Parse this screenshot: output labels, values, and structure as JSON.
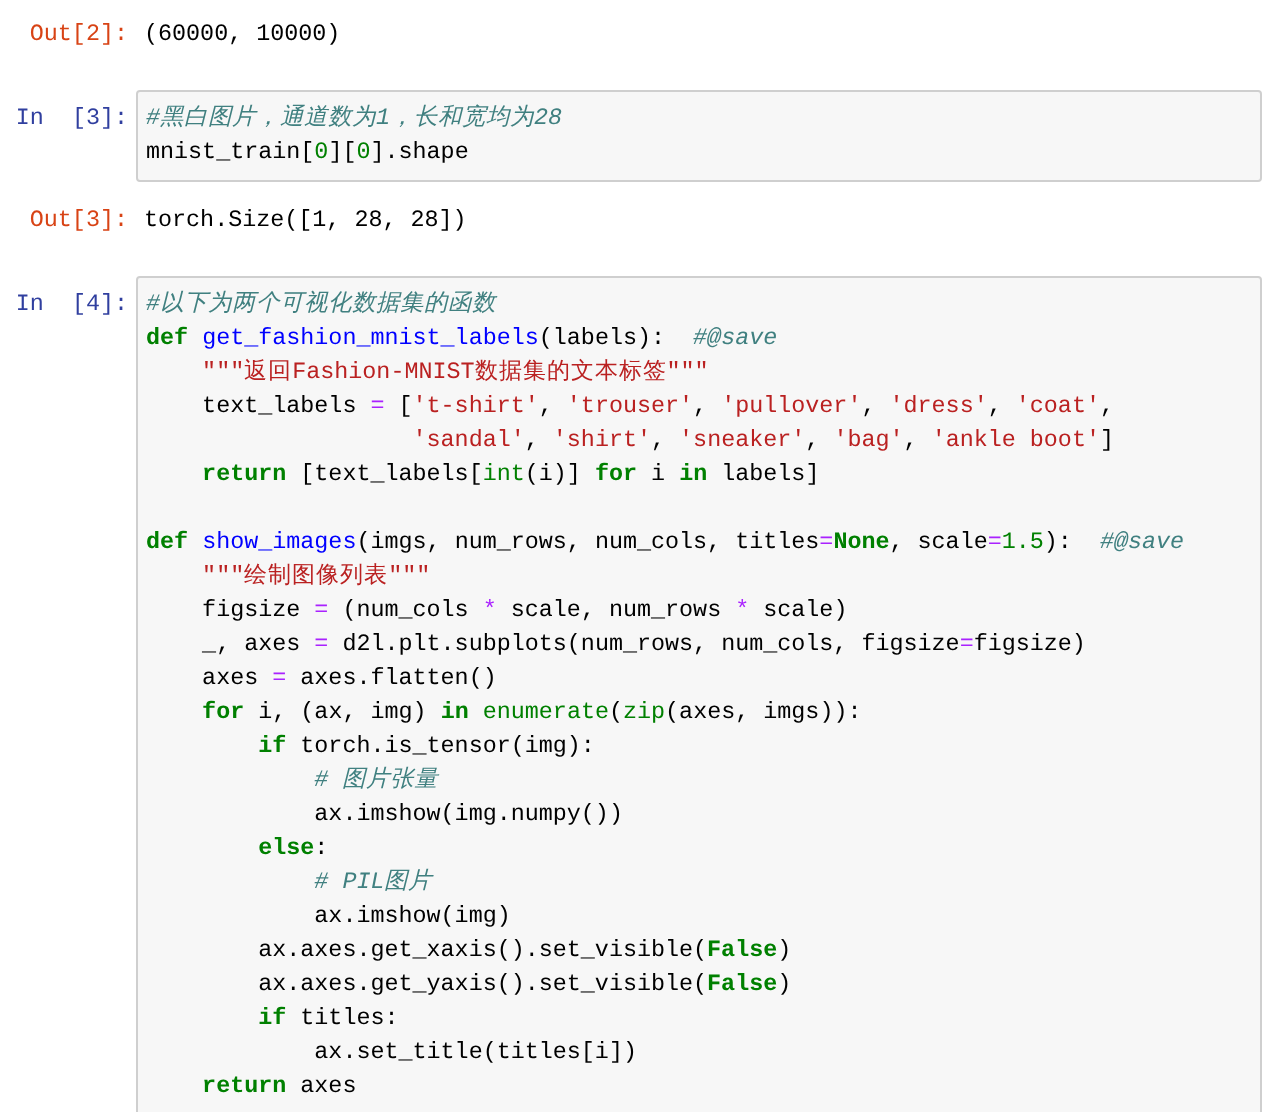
{
  "cells": [
    {
      "kind": "output",
      "prompt": "Out[2]:",
      "text": "(60000, 10000)"
    },
    {
      "kind": "input",
      "prompt": "In  [3]:",
      "blocks": [
        [
          [
            {
              "text": "#黑白图片，通道数为1，长和宽均为28",
              "kind": "comment"
            }
          ],
          [
            {
              "text": "mnist_train[",
              "kind": "plain"
            },
            {
              "text": "0",
              "kind": "number"
            },
            {
              "text": "][",
              "kind": "plain"
            },
            {
              "text": "0",
              "kind": "number"
            },
            {
              "text": "].shape",
              "kind": "plain"
            }
          ]
        ]
      ]
    },
    {
      "kind": "output",
      "prompt": "Out[3]:",
      "text": "torch.Size([1, 28, 28])"
    },
    {
      "kind": "input",
      "prompt": "In  [4]:",
      "blocks": [
        [
          [
            {
              "text": "#以下为两个可视化数据集的函数",
              "kind": "comment"
            }
          ],
          [
            {
              "text": "def ",
              "kind": "keyword"
            },
            {
              "text": "get_fashion_mnist_labels",
              "kind": "function"
            },
            {
              "text": "(labels):  ",
              "kind": "plain"
            },
            {
              "text": "#@save",
              "kind": "comment"
            }
          ],
          [
            {
              "text": "    \"\"\"返回Fashion-MNIST数据集的文本标签\"\"\"",
              "kind": "string"
            }
          ],
          [
            {
              "text": "    text_labels ",
              "kind": "plain"
            },
            {
              "text": "=",
              "kind": "operator"
            },
            {
              "text": " [",
              "kind": "plain"
            },
            {
              "text": "'t-shirt'",
              "kind": "string"
            },
            {
              "text": ", ",
              "kind": "plain"
            },
            {
              "text": "'trouser'",
              "kind": "string"
            },
            {
              "text": ", ",
              "kind": "plain"
            },
            {
              "text": "'pullover'",
              "kind": "string"
            },
            {
              "text": ", ",
              "kind": "plain"
            },
            {
              "text": "'dress'",
              "kind": "string"
            },
            {
              "text": ", ",
              "kind": "plain"
            },
            {
              "text": "'coat'",
              "kind": "string"
            },
            {
              "text": ",",
              "kind": "plain"
            }
          ],
          [
            {
              "text": "                   'sandal'",
              "kind": "string"
            },
            {
              "text": ", ",
              "kind": "plain"
            },
            {
              "text": "'shirt'",
              "kind": "string"
            },
            {
              "text": ", ",
              "kind": "plain"
            },
            {
              "text": "'sneaker'",
              "kind": "string"
            },
            {
              "text": ", ",
              "kind": "plain"
            },
            {
              "text": "'bag'",
              "kind": "string"
            },
            {
              "text": ", ",
              "kind": "plain"
            },
            {
              "text": "'ankle boot'",
              "kind": "string"
            },
            {
              "text": "]",
              "kind": "plain"
            }
          ],
          [
            {
              "text": "    return",
              "kind": "keyword"
            },
            {
              "text": " [text_labels[",
              "kind": "plain"
            },
            {
              "text": "int",
              "kind": "builtin"
            },
            {
              "text": "(i)] ",
              "kind": "plain"
            },
            {
              "text": "for",
              "kind": "keyword"
            },
            {
              "text": " i ",
              "kind": "plain"
            },
            {
              "text": "in",
              "kind": "keyword"
            },
            {
              "text": " labels]",
              "kind": "plain"
            }
          ]
        ],
        [
          [
            {
              "text": "def ",
              "kind": "keyword"
            },
            {
              "text": "show_images",
              "kind": "function"
            },
            {
              "text": "(imgs, num_rows, num_cols, titles",
              "kind": "plain"
            },
            {
              "text": "=",
              "kind": "operator"
            },
            {
              "text": "None",
              "kind": "keyword"
            },
            {
              "text": ", scale",
              "kind": "plain"
            },
            {
              "text": "=",
              "kind": "operator"
            },
            {
              "text": "1.5",
              "kind": "number"
            },
            {
              "text": "):  ",
              "kind": "plain"
            },
            {
              "text": "#@save",
              "kind": "comment"
            }
          ],
          [
            {
              "text": "    \"\"\"绘制图像列表\"\"\"",
              "kind": "string"
            }
          ],
          [
            {
              "text": "    figsize ",
              "kind": "plain"
            },
            {
              "text": "=",
              "kind": "operator"
            },
            {
              "text": " (num_cols ",
              "kind": "plain"
            },
            {
              "text": "*",
              "kind": "operator"
            },
            {
              "text": " scale, num_rows ",
              "kind": "plain"
            },
            {
              "text": "*",
              "kind": "operator"
            },
            {
              "text": " scale)",
              "kind": "plain"
            }
          ],
          [
            {
              "text": "    _, axes ",
              "kind": "plain"
            },
            {
              "text": "=",
              "kind": "operator"
            },
            {
              "text": " d2l.plt.subplots(num_rows, num_cols, figsize",
              "kind": "plain"
            },
            {
              "text": "=",
              "kind": "operator"
            },
            {
              "text": "figsize)",
              "kind": "plain"
            }
          ],
          [
            {
              "text": "    axes ",
              "kind": "plain"
            },
            {
              "text": "=",
              "kind": "operator"
            },
            {
              "text": " axes.flatten()",
              "kind": "plain"
            }
          ],
          [
            {
              "text": "    for",
              "kind": "keyword"
            },
            {
              "text": " i, (ax, img) ",
              "kind": "plain"
            },
            {
              "text": "in",
              "kind": "keyword"
            },
            {
              "text": " enumerate",
              "kind": "builtin"
            },
            {
              "text": "(",
              "kind": "plain"
            },
            {
              "text": "zip",
              "kind": "builtin"
            },
            {
              "text": "(axes, imgs)):",
              "kind": "plain"
            }
          ],
          [
            {
              "text": "        if",
              "kind": "keyword"
            },
            {
              "text": " torch.is_tensor(img):",
              "kind": "plain"
            }
          ],
          [
            {
              "text": "            # 图片张量",
              "kind": "comment"
            }
          ],
          [
            {
              "text": "            ax.imshow(img.numpy())",
              "kind": "plain"
            }
          ],
          [
            {
              "text": "        else",
              "kind": "keyword"
            },
            {
              "text": ":",
              "kind": "plain"
            }
          ],
          [
            {
              "text": "            # PIL图片",
              "kind": "comment"
            }
          ],
          [
            {
              "text": "            ax.imshow(img)",
              "kind": "plain"
            }
          ],
          [
            {
              "text": "        ax.axes.get_xaxis().set_visible(",
              "kind": "plain"
            },
            {
              "text": "False",
              "kind": "keyword"
            },
            {
              "text": ")",
              "kind": "plain"
            }
          ],
          [
            {
              "text": "        ax.axes.get_yaxis().set_visible(",
              "kind": "plain"
            },
            {
              "text": "False",
              "kind": "keyword"
            },
            {
              "text": ")",
              "kind": "plain"
            }
          ],
          [
            {
              "text": "        if",
              "kind": "keyword"
            },
            {
              "text": " titles:",
              "kind": "plain"
            }
          ],
          [
            {
              "text": "            ax.set_title(titles[i])",
              "kind": "plain"
            }
          ],
          [
            {
              "text": "    return",
              "kind": "keyword"
            },
            {
              "text": " axes",
              "kind": "plain"
            }
          ]
        ]
      ]
    }
  ]
}
